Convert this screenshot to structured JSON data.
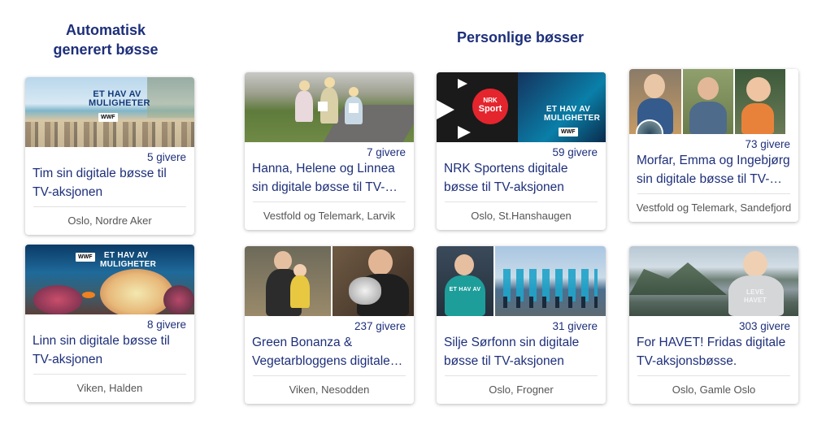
{
  "headings": {
    "auto": "Automatisk\ngenerert bøsse",
    "personal": "Personlige bøsser"
  },
  "cards": [
    {
      "count": "5 givere",
      "title": "Tim sin digitale bøsse til TV-aksjonen",
      "location": "Oslo, Nordre Aker",
      "image_text": "ET HAV AV MULIGHETER",
      "logo": "WWF"
    },
    {
      "count": "7 givere",
      "title": "Hanna, Helene og Linnea sin digitale bøsse til TV-aksjonen",
      "location": "Vestfold og Telemark, Larvik"
    },
    {
      "count": "59 givere",
      "title": "NRK Sportens digitale bøsse til TV-aksjonen",
      "location": "Oslo, St.Hanshaugen",
      "image_text": "ET HAV AV MULIGHETER",
      "logo_nrk": "NRK",
      "logo_sport": "Sport",
      "logo": "WWF"
    },
    {
      "count": "73 givere",
      "title": "Morfar, Emma og Ingebjørg sin digitale bøsse til TV-aksjonen",
      "location": "Vestfold og Telemark, Sandefjord"
    },
    {
      "count": "8 givere",
      "title": "Linn sin digitale bøsse til TV-aksjonen",
      "location": "Viken, Halden",
      "image_text": "ET HAV AV MULIGHETER",
      "logo": "WWF"
    },
    {
      "count": "237 givere",
      "title": "Green Bonanza & Vegetarbloggens digitale bøsse til TV-aksjonen",
      "location": "Viken, Nesodden"
    },
    {
      "count": "31 givere",
      "title": "Silje Sørfonn sin digitale bøsse til TV-aksjonen",
      "location": "Oslo, Frogner",
      "shirt_text": "ET HAV AV"
    },
    {
      "count": "303 givere",
      "title": "For HAVET! Fridas digitale TV-aksjonsbøsse.",
      "location": "Oslo, Gamle Oslo",
      "shirt_text": "LEVE HAVET"
    }
  ],
  "colors": {
    "heading": "#1d2f7a",
    "title": "#1d2f7a",
    "location": "#555555"
  }
}
